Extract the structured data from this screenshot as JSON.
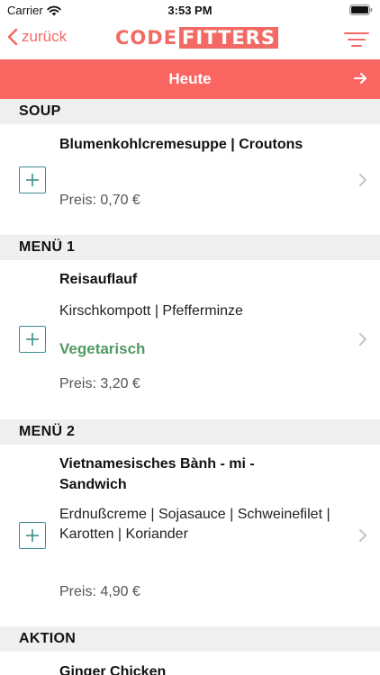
{
  "status": {
    "carrier": "Carrier",
    "time": "3:53 PM"
  },
  "nav": {
    "back_label": "zurück",
    "logo_part_a": "CODE",
    "logo_part_b": "FITTERS"
  },
  "day": {
    "label": "Heute"
  },
  "sections": [
    {
      "header": "SOUP",
      "item": {
        "title": "Blumenkohlcremesuppe | Croutons",
        "sides": "",
        "tag": "",
        "price": "Preis: 0,70 €"
      }
    },
    {
      "header": "MENÜ 1",
      "item": {
        "title": "Reisauflauf",
        "sides": "Kirschkompott | Pfefferminze",
        "tag": "Vegetarisch",
        "price": "Preis: 3,20 €"
      }
    },
    {
      "header": "MENÜ 2",
      "item": {
        "title": "Vietnamesisches Bành - mi - Sandwich",
        "sides": "Erdnußcreme | Sojasauce | Schweinefilet | Karotten | Koriander",
        "tag": "",
        "price": "Preis: 4,90 €"
      }
    },
    {
      "header": "AKTION",
      "item": {
        "title": "Ginger Chicken",
        "sides": "",
        "tag": "",
        "price": ""
      }
    }
  ],
  "colors": {
    "accent": "#fb6662",
    "add_border": "#3c8d8d",
    "vegetarian": "#4f9a62",
    "section_bg": "#efefef"
  },
  "icons": [
    "wifi-icon",
    "battery-icon",
    "chevron-left-icon",
    "filter-icon",
    "arrow-right-icon",
    "plus-icon",
    "chevron-right-icon"
  ]
}
